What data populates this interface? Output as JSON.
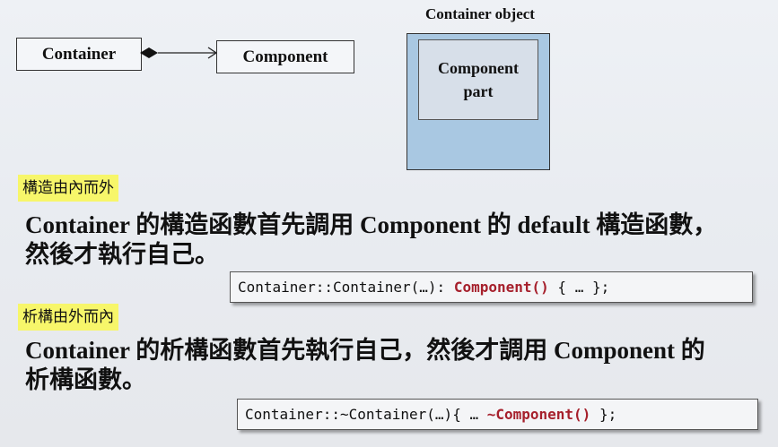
{
  "diagram": {
    "container_label": "Container",
    "component_label": "Component",
    "object_title": "Container object",
    "part_line1": "Component",
    "part_line2": "part"
  },
  "section1": {
    "tag": "構造由內而外",
    "line1": "Container 的構造函數首先調用 Component 的 default 構造函數，",
    "line2": "然後才執行自己。",
    "code_prefix": "Container::Container(…): ",
    "code_call": "Component()",
    "code_suffix": " { … };"
  },
  "section2": {
    "tag": "析構由外而內",
    "line1": "Container 的析構函數首先執行自己，然後才調用 Component 的",
    "line2": "析構函數。",
    "code_prefix": "Container::~Container(…){ … ",
    "code_call": "~Component()",
    "code_suffix": " };"
  },
  "colors": {
    "highlight": "#f7f66a",
    "object_fill": "#a9c8e2",
    "code_keyword": "#a6202c"
  }
}
